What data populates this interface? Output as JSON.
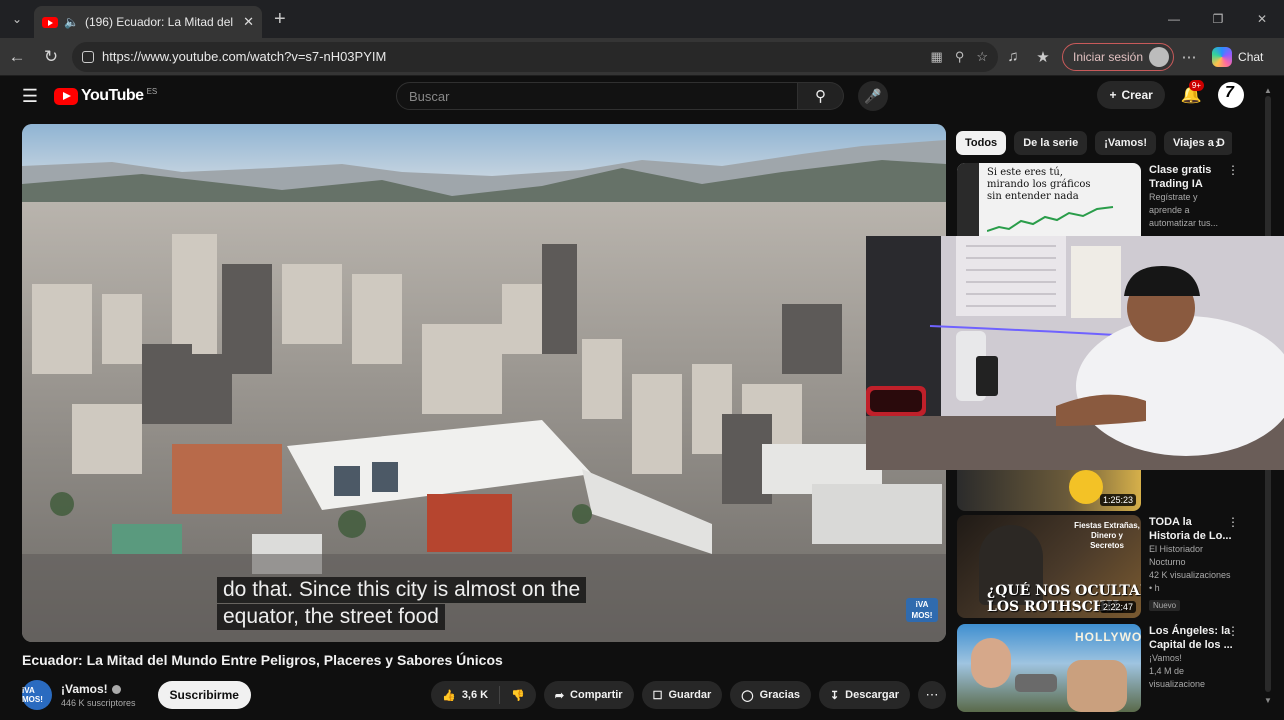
{
  "browser": {
    "tab_title": "(196) Ecuador: La Mitad del M",
    "url": "https://www.youtube.com/watch?v=s7-nH03PYIM",
    "signin_label": "Iniciar sesión",
    "chat_label": "Chat"
  },
  "youtube": {
    "logo_text": "YouTube",
    "country_code": "ES",
    "search_placeholder": "Buscar",
    "create_label": "Crear",
    "notifications_badge": "9+"
  },
  "video": {
    "caption_lines": [
      "do that. Since this city is almost on the",
      "equator, the street food"
    ],
    "watermark": "iVA MOS!",
    "title": "Ecuador: La Mitad del Mundo Entre Peligros, Placeres y Sabores Únicos",
    "channel_name": "¡Vamos!",
    "channel_avatar_text": "iVA MOS!",
    "subscribers": "446 K suscriptores",
    "subscribe_label": "Suscribirme",
    "likes": "3,6 K",
    "share_label": "Compartir",
    "save_label": "Guardar",
    "thanks_label": "Gracias",
    "download_label": "Descargar"
  },
  "chips": [
    "Todos",
    "De la serie",
    "¡Vamos!",
    "Viajes a D"
  ],
  "recommendations": [
    {
      "title_lines": [
        "Clase gratis",
        "Trading IA"
      ],
      "lines": [
        "Regístrate y",
        "aprende a",
        "automatizar tus..."
      ],
      "thumb_text": [
        "Si este eres tú,",
        "mirando los gráficos",
        "sin entender nada"
      ]
    },
    {
      "duration": "1:25:23"
    },
    {
      "title_lines": [
        "TODA la",
        "Historia de Lo..."
      ],
      "lines": [
        "El Historiador Nocturno",
        "42 K visualizaciones • h"
      ],
      "badge": "Nuevo",
      "thumb_text": [
        "Fiestas Extrañas,",
        "Dinero y Secretos",
        "¿QUÉ NOS OCULTAN",
        "LOS ROTHSCHIL"
      ],
      "duration": "2:22:47"
    },
    {
      "title_lines": [
        "Los Ángeles: la",
        "Capital de los ..."
      ],
      "lines": [
        "¡Vamos!",
        "1,4 M de visualizacione"
      ],
      "thumb_text": [
        "HOLLYWOOD"
      ]
    }
  ]
}
